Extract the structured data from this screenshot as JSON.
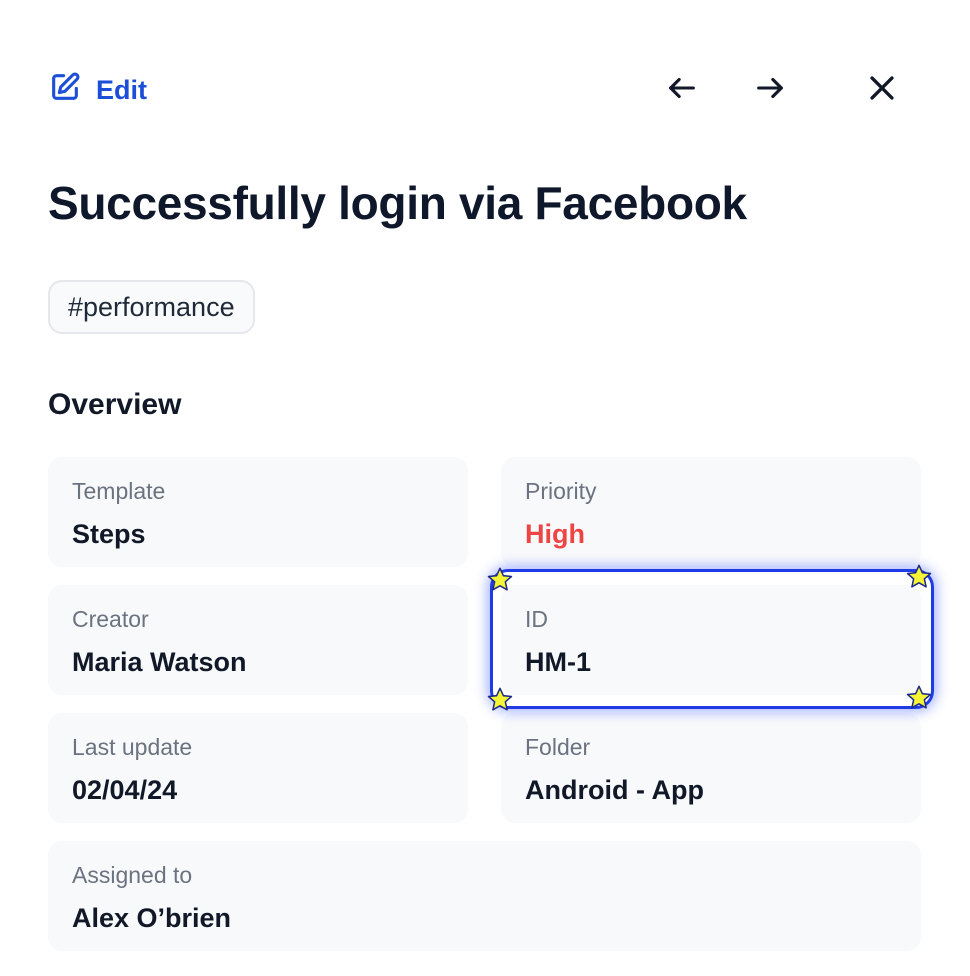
{
  "header": {
    "edit_label": "Edit",
    "icons": {
      "edit": "pencil-square-icon",
      "prev": "arrow-left-icon",
      "next": "arrow-right-icon",
      "close": "close-icon"
    }
  },
  "title": "Successfully login via Facebook",
  "tag": "#performance",
  "overview": {
    "section_title": "Overview",
    "fields": [
      {
        "label": "Template",
        "value": "Steps"
      },
      {
        "label": "Priority",
        "value": "High"
      },
      {
        "label": "Creator",
        "value": "Maria Watson"
      },
      {
        "label": "ID",
        "value": "HM-1"
      },
      {
        "label": "Last update",
        "value": "02/04/24"
      },
      {
        "label": "Folder",
        "value": "Android - App"
      },
      {
        "label": "Assigned to",
        "value": "Alex O’brien"
      }
    ]
  },
  "colors": {
    "accent": "#1d4ed8",
    "priority_high": "#ef4444",
    "highlight_border": "#1e3be6",
    "star_fill": "#f5f536"
  }
}
